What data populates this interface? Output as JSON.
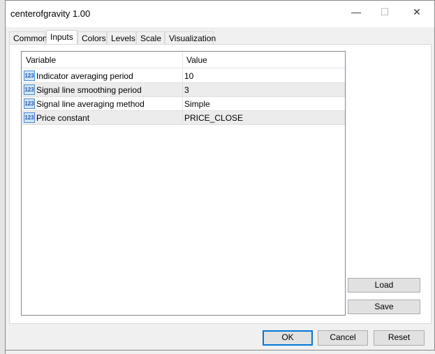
{
  "window": {
    "title": "centerofgravity 1.00",
    "minimize": "—",
    "maximize": "☐",
    "close": "✕"
  },
  "tabs": [
    {
      "label": "Common"
    },
    {
      "label": "Inputs",
      "active": true
    },
    {
      "label": "Colors"
    },
    {
      "label": "Levels"
    },
    {
      "label": "Scale"
    },
    {
      "label": "Visualization"
    }
  ],
  "table": {
    "columns": [
      "Variable",
      "Value"
    ],
    "rows": [
      {
        "icon": "123",
        "variable": "Indicator averaging period",
        "value": "10"
      },
      {
        "icon": "123",
        "variable": "Signal line smoothing period",
        "value": "3"
      },
      {
        "icon": "123",
        "variable": "Signal line averaging method",
        "value": "Simple"
      },
      {
        "icon": "123",
        "variable": "Price constant",
        "value": "PRICE_CLOSE"
      }
    ]
  },
  "buttons": {
    "load": "Load",
    "save": "Save",
    "ok": "OK",
    "cancel": "Cancel",
    "reset": "Reset"
  },
  "colors": {
    "accent": "#0078d7"
  }
}
